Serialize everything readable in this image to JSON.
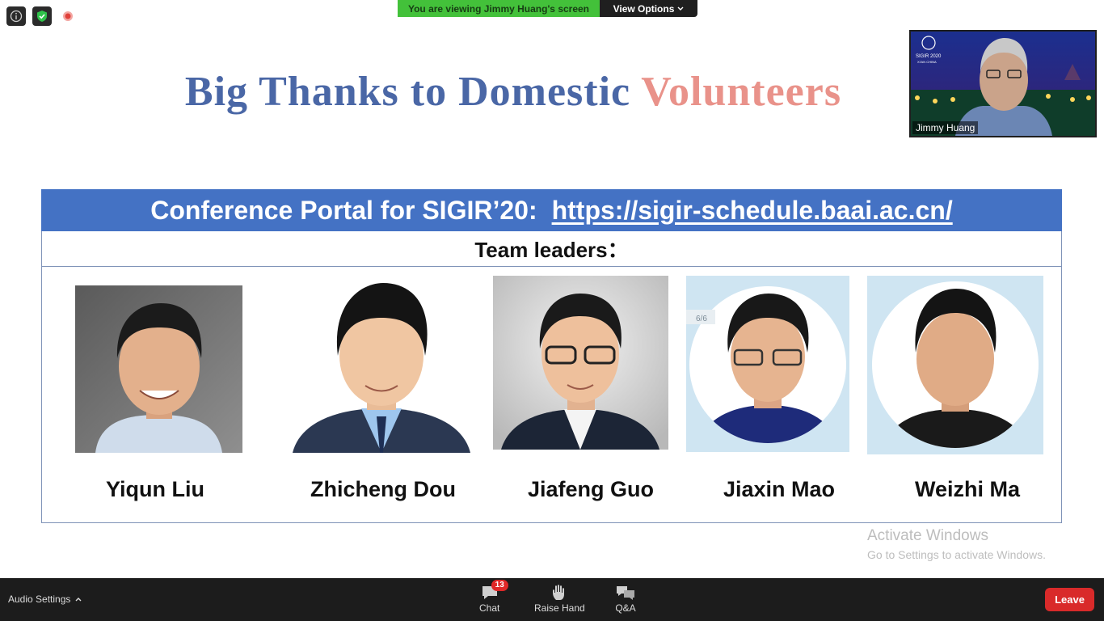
{
  "banner": {
    "viewing_text": "You are viewing Jimmy Huang's screen",
    "view_options_label": "View Options"
  },
  "slide": {
    "title_main": "Big Thanks to Domestic",
    "title_accent": "Volunteers",
    "portal_label": "Conference Portal for SIGIR’20:",
    "portal_url": "https://sigir-schedule.baai.ac.cn/",
    "team_header": "Team leaders：",
    "page_indicator": "6/6",
    "people": [
      {
        "name": "Yiqun Liu"
      },
      {
        "name": "Zhicheng Dou"
      },
      {
        "name": "Jiafeng Guo"
      },
      {
        "name": "Jiaxin Mao"
      },
      {
        "name": "Weizhi Ma"
      }
    ]
  },
  "self_view": {
    "name": "Jimmy Huang",
    "logo_text_1": "SIGIR 2020",
    "logo_text_2": "XI'AN CHINA"
  },
  "watermark": {
    "line1": "Activate Windows",
    "line2": "Go to Settings to activate Windows."
  },
  "toolbar": {
    "audio_settings": "Audio Settings",
    "chat_label": "Chat",
    "chat_count": "13",
    "raise_hand_label": "Raise Hand",
    "qa_label": "Q&A",
    "leave_label": "Leave"
  },
  "colors": {
    "accent_blue": "#4472c4",
    "title_blue": "#4a67a6",
    "title_pink": "#e9928a",
    "banner_green": "#43c13a",
    "leave_red": "#d92a2a"
  }
}
